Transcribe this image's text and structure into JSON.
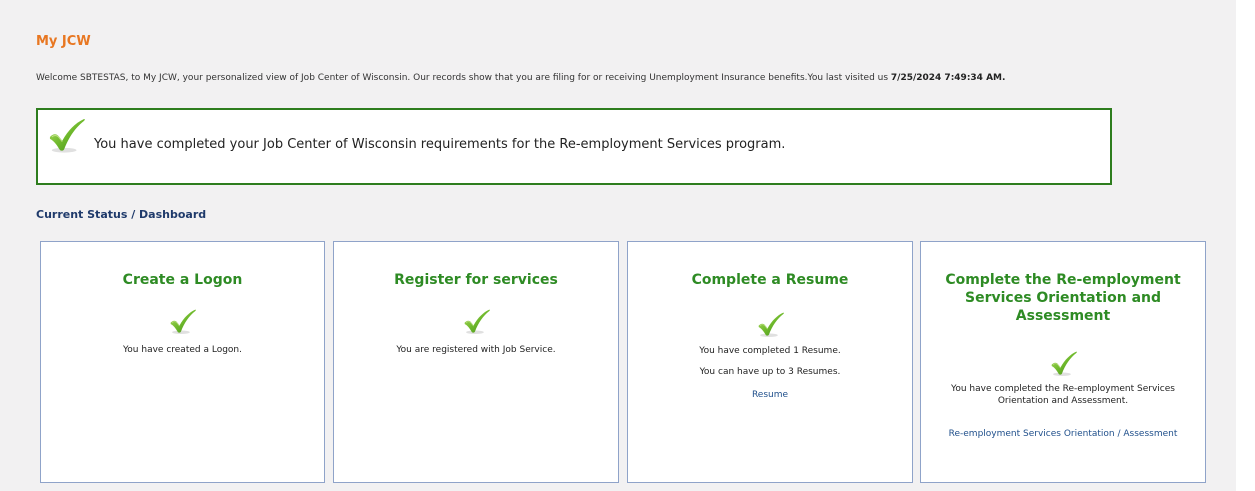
{
  "header": {
    "title": "My JCW"
  },
  "welcome": {
    "text": "Welcome SBTESTAS, to My JCW, your personalized view of Job Center of Wisconsin. Our records show that you are filing for or receiving Unemployment Insurance benefits.You last visited us ",
    "last_visit": "7/25/2024 7:49:34 AM."
  },
  "completion": {
    "icon": "checkmark-icon",
    "message": "You have completed your Job Center of Wisconsin requirements for the Re-employment Services program."
  },
  "dashboard": {
    "section_title": "Current Status / Dashboard",
    "cards": [
      {
        "title": "Create a Logon",
        "status_icon": "checkmark-icon",
        "text": "You have created a Logon."
      },
      {
        "title": "Register for services",
        "status_icon": "checkmark-icon",
        "text": "You are registered with Job Service."
      },
      {
        "title": "Complete a Resume",
        "status_icon": "checkmark-icon",
        "text": "You have completed 1 Resume.",
        "text2": "You can have up to 3 Resumes.",
        "link": "Resume"
      },
      {
        "title": "Complete the Re-employment Services Orientation and Assessment",
        "status_icon": "checkmark-icon",
        "text": "You have completed the Re-employment Services Orientation and Assessment.",
        "link": "Re-employment Services Orientation / Assessment"
      }
    ]
  },
  "colors": {
    "accent_orange": "#e87722",
    "success_green": "#2e8b24",
    "link_blue": "#1f4f8b",
    "card_border": "#8fa3c9"
  }
}
